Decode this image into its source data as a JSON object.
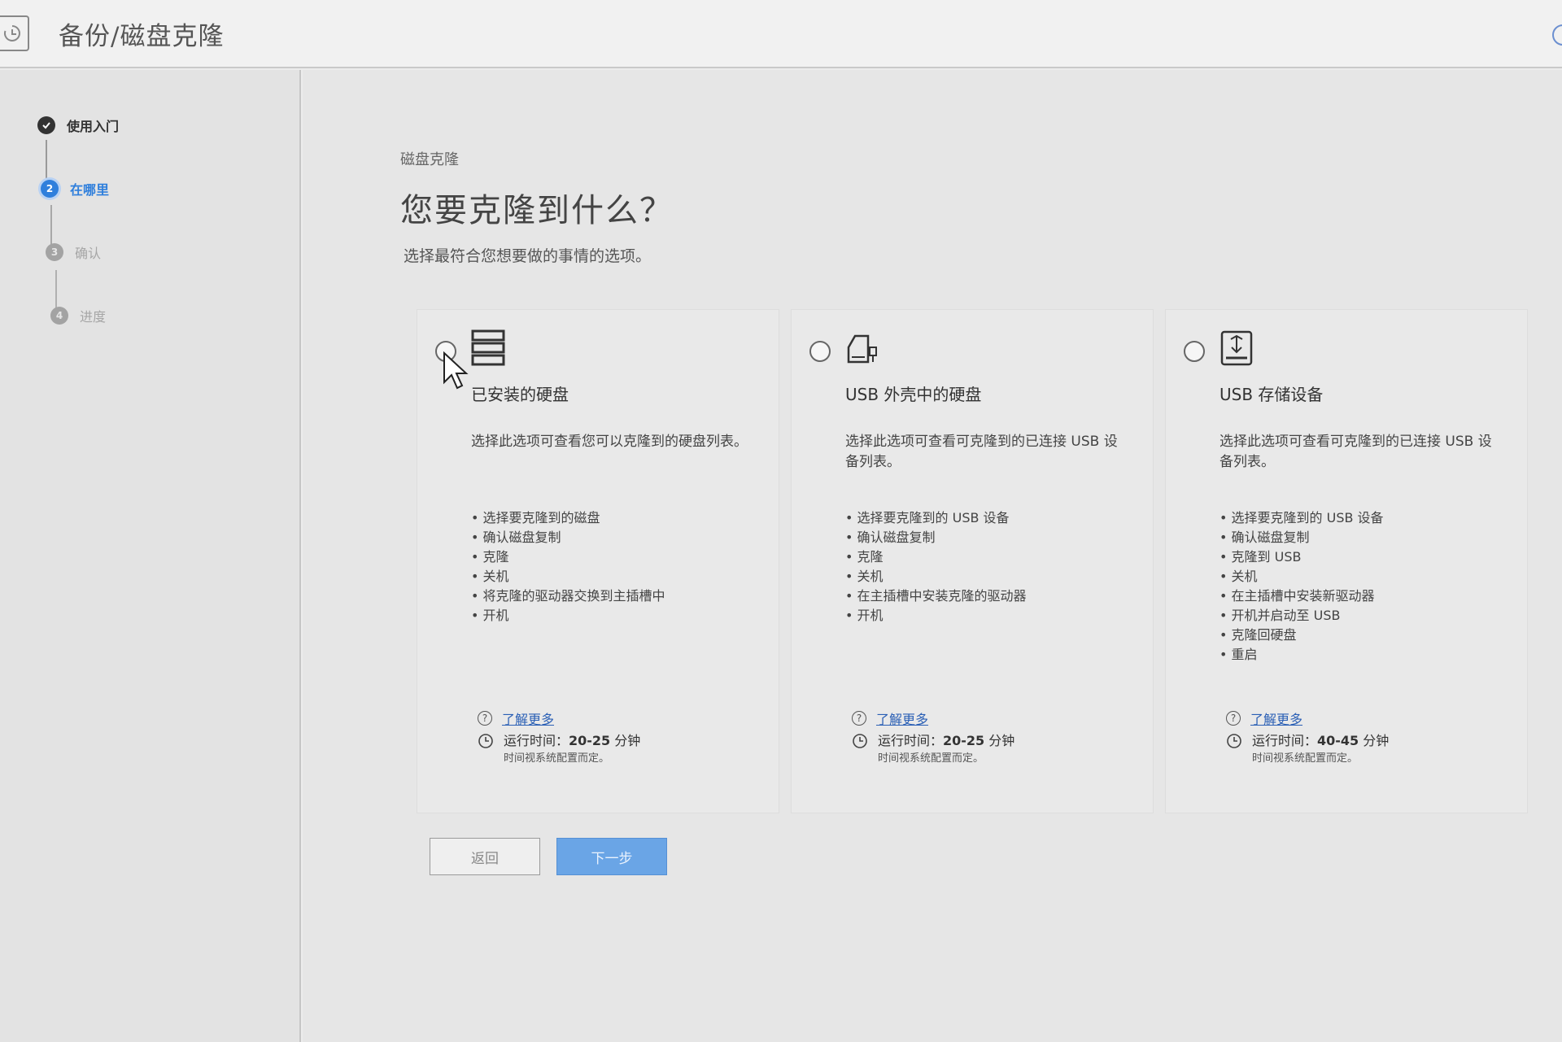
{
  "window": {
    "title": "备份/磁盘克隆"
  },
  "sidebar": {
    "steps": [
      {
        "num": "",
        "label": "使用入门",
        "state": "done"
      },
      {
        "num": "2",
        "label": "在哪里",
        "state": "active"
      },
      {
        "num": "3",
        "label": "确认",
        "state": "todo"
      },
      {
        "num": "4",
        "label": "进度",
        "state": "todo"
      }
    ]
  },
  "main": {
    "breadcrumb": "磁盘克隆",
    "heading": "您要克隆到什么？",
    "subheading": "选择最符合您想要做的事情的选项。",
    "cards": [
      {
        "icon": "server-disk-icon",
        "title": "已安装的硬盘",
        "desc": "选择此选项可查看您可以克隆到的硬盘列表。",
        "steps": [
          "选择要克隆到的磁盘",
          "确认磁盘复制",
          "克隆",
          "关机",
          "将克隆的驱动器交换到主插槽中",
          "开机"
        ],
        "learn_more": "了解更多",
        "runtime_label": "运行时间：",
        "runtime_value": "20-25",
        "runtime_unit": " 分钟",
        "runtime_note": "时间视系统配置而定。"
      },
      {
        "icon": "usb-enclosure-icon",
        "title": "USB 外壳中的硬盘",
        "desc": "选择此选项可查看可克隆到的已连接 USB 设备列表。",
        "steps": [
          "选择要克隆到的 USB 设备",
          "确认磁盘复制",
          "克隆",
          "关机",
          "在主插槽中安装克隆的驱动器",
          "开机"
        ],
        "learn_more": "了解更多",
        "runtime_label": "运行时间：",
        "runtime_value": "20-25",
        "runtime_unit": " 分钟",
        "runtime_note": "时间视系统配置而定。"
      },
      {
        "icon": "usb-storage-icon",
        "title": "USB 存储设备",
        "desc": "选择此选项可查看可克隆到的已连接 USB 设备列表。",
        "steps": [
          "选择要克隆到的 USB 设备",
          "确认磁盘复制",
          "克隆到 USB",
          "关机",
          "在主插槽中安装新驱动器",
          "开机并启动至 USB",
          "克隆回硬盘",
          "重启"
        ],
        "learn_more": "了解更多",
        "runtime_label": "运行时间：",
        "runtime_value": "40-45",
        "runtime_unit": " 分钟",
        "runtime_note": "时间视系统配置而定。"
      }
    ],
    "buttons": {
      "back": "返回",
      "next": "下一步"
    }
  },
  "colors": {
    "accent": "#2f7fdc",
    "next_button": "#6aa5e6",
    "link": "#2a5fb5"
  }
}
